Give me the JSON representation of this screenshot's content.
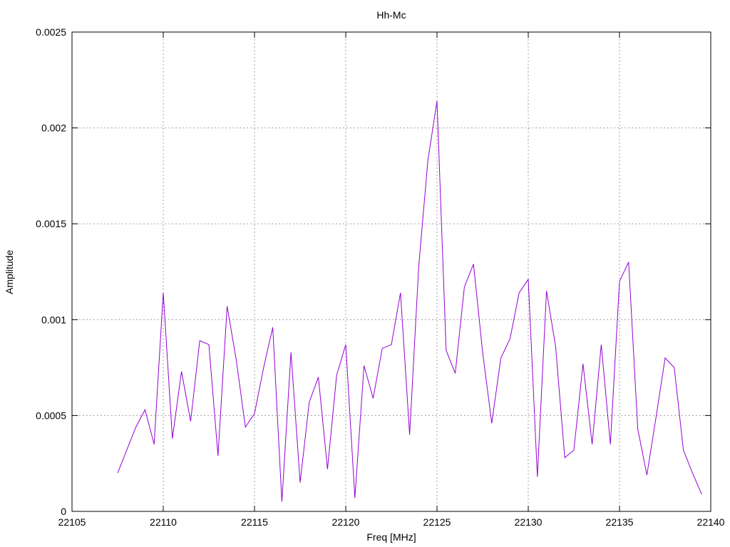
{
  "chart_data": {
    "type": "line",
    "title": "Hh-Mc",
    "xlabel": "Freq [MHz]",
    "ylabel": "Amplitude",
    "xlim": [
      22105,
      22140
    ],
    "ylim": [
      0,
      0.0025
    ],
    "xticks": [
      "22105",
      "22110",
      "22115",
      "22120",
      "22125",
      "22130",
      "22135",
      "22140"
    ],
    "yticks": [
      "0",
      "0.0005",
      "0.001",
      "0.0015",
      "0.002",
      "0.0025"
    ],
    "grid": true,
    "series_color": "#9400d3",
    "series": [
      {
        "x": [
          22107.5,
          22108.0,
          22108.5,
          22109.0,
          22109.5,
          22110.0,
          22110.5,
          22111.0,
          22111.5,
          22112.0,
          22112.5,
          22113.0,
          22113.5,
          22114.0,
          22114.5,
          22115.0,
          22115.5,
          22116.0,
          22116.5,
          22117.0,
          22117.5,
          22118.0,
          22118.5,
          22119.0,
          22119.5,
          22120.0,
          22120.5,
          22121.0,
          22121.5,
          22122.0,
          22122.5,
          22123.0,
          22123.5,
          22124.0,
          22124.5,
          22125.0,
          22125.5,
          22126.0,
          22126.5,
          22127.0,
          22127.5,
          22128.0,
          22128.5,
          22129.0,
          22129.5,
          22130.0,
          22130.5,
          22131.0,
          22131.5,
          22132.0,
          22132.5,
          22133.0,
          22133.5,
          22134.0,
          22134.5,
          22135.0,
          22135.5,
          22136.0,
          22136.5,
          22137.0,
          22137.5,
          22138.0,
          22138.5,
          22139.0,
          22139.5
        ],
        "values": [
          0.0002,
          0.00032,
          0.00044,
          0.00053,
          0.00035,
          0.00114,
          0.00038,
          0.00073,
          0.00047,
          0.00089,
          0.00087,
          0.00029,
          0.00107,
          0.00079,
          0.00044,
          0.00051,
          0.00075,
          0.00096,
          5e-05,
          0.00083,
          0.00015,
          0.00057,
          0.0007,
          0.00022,
          0.00071,
          0.00087,
          7e-05,
          0.00076,
          0.00059,
          0.00085,
          0.00087,
          0.00114,
          0.0004,
          0.00128,
          0.00183,
          0.00214,
          0.00084,
          0.00072,
          0.00117,
          0.00129,
          0.00083,
          0.00046,
          0.0008,
          0.0009,
          0.00114,
          0.00121,
          0.00018,
          0.00115,
          0.00086,
          0.00028,
          0.00032,
          0.00077,
          0.00035,
          0.00087,
          0.00035,
          0.0012,
          0.0013,
          0.00043,
          0.00019,
          0.00049,
          0.0008,
          0.00075,
          0.00032,
          0.0002,
          9e-05
        ]
      }
    ]
  }
}
